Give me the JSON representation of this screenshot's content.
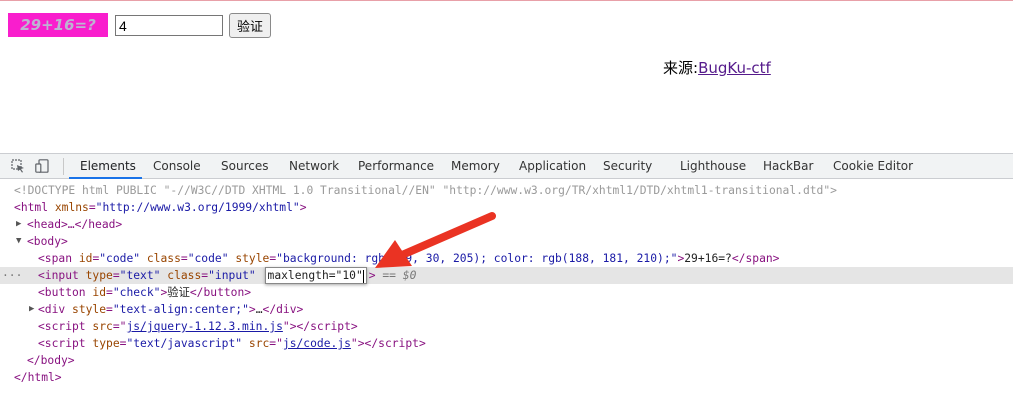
{
  "page": {
    "captcha": {
      "text": "29+16=?",
      "background": "#f91ecd",
      "color": "#bcb5d2"
    },
    "answer_input": {
      "value": "4"
    },
    "verify_button": {
      "label": "验证"
    },
    "source": {
      "prefix": "来源:",
      "link_text": "BugKu-ctf"
    }
  },
  "devtools": {
    "tabs": [
      "Elements",
      "Console",
      "Sources",
      "Network",
      "Performance",
      "Memory",
      "Application",
      "Security",
      "Lighthouse",
      "HackBar",
      "Cookie Editor"
    ],
    "active_tab": "Elements",
    "icons": [
      "inspect-element-icon",
      "device-toggle-icon"
    ],
    "dom": {
      "doctype": "<!DOCTYPE html PUBLIC \"-//W3C//DTD XHTML 1.0 Transitional//EN\" \"http://www.w3.org/TR/xhtml1/DTD/xhtml1-transitional.dtd\">",
      "html_open": {
        "tag": "html",
        "attr": "xmlns",
        "val": "\"http://www.w3.org/1999/xhtml\""
      },
      "head": {
        "text": "<head>…</head>"
      },
      "body_open": "<body>",
      "span": {
        "id_val": "\"code\"",
        "class_val": "\"code\"",
        "style_val": "\"background: rgb(249, 30, 205); color: rgb(188, 181, 210);\"",
        "text": "29+16=?"
      },
      "input": {
        "type_val": "\"text\"",
        "class_val": "\"input\"",
        "editing": "maxlength=\"10\"",
        "trailer": "== $0"
      },
      "button": {
        "id_val": "\"check\"",
        "text": "验证"
      },
      "div": {
        "style_val": "\"text-align:center;\"",
        "text": "…"
      },
      "script1": {
        "src_val": "js/jquery-1.12.3.min.js"
      },
      "script2": {
        "type_val": "\"text/javascript\"",
        "src_val": "js/code.js"
      },
      "body_close": "</body>",
      "html_close": "</html>"
    }
  },
  "colors": {
    "arrow": "#ea3323",
    "active_tab_underline": "#1a73e8",
    "link_visited": "#551a8b"
  }
}
